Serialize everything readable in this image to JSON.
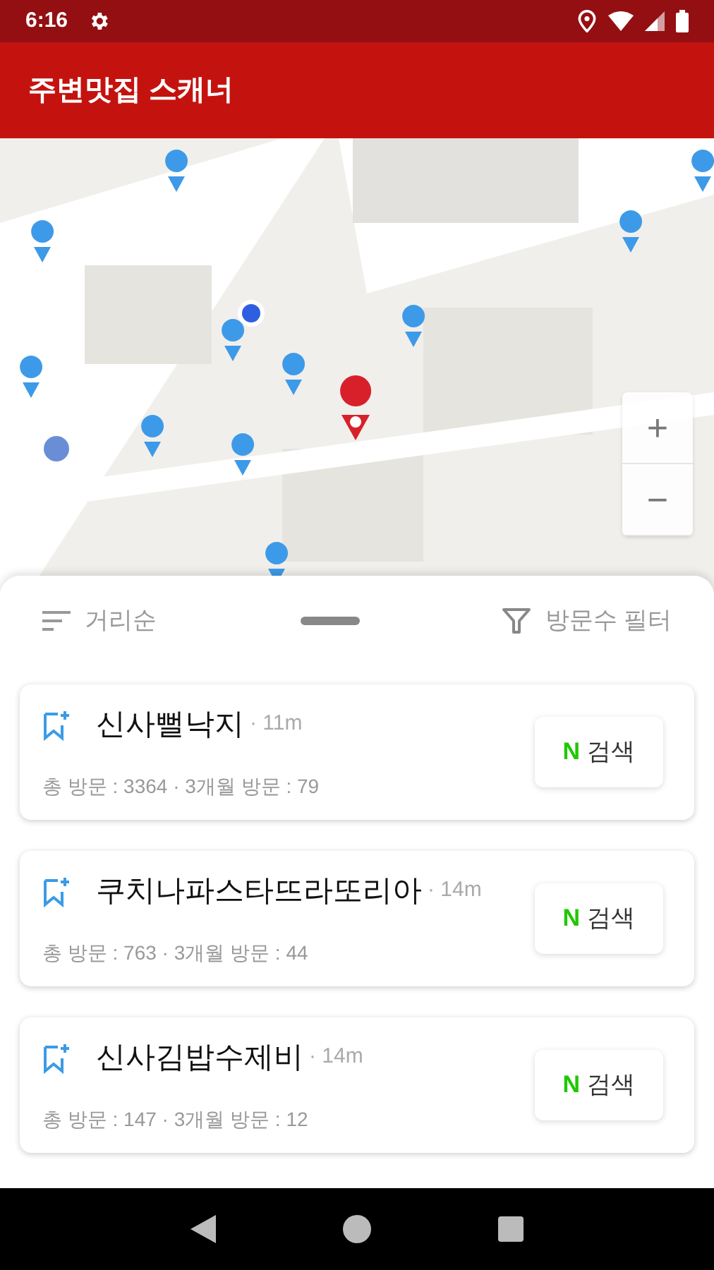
{
  "status_bar": {
    "time": "6:16"
  },
  "app_bar": {
    "title": "주변맛집 스캐너"
  },
  "map": {
    "kind": "picture",
    "zoom_controls": [
      "+",
      "−"
    ]
  },
  "sheet": {
    "sort": {
      "label": "거리순"
    },
    "filter": {
      "label": "방문수 필터"
    }
  },
  "restaurants": [
    {
      "name": "신사뻘낙지",
      "distance": "· 11m",
      "stats": "총 방문 : 3364 · 3개월 방문 : 79",
      "search": {
        "brand": "N",
        "label": "검색"
      }
    },
    {
      "name": "쿠치나파스타뜨라또리아",
      "distance": "· 14m",
      "stats": "총 방문 : 763 · 3개월 방문 : 44",
      "search": {
        "brand": "N",
        "label": "검색"
      }
    },
    {
      "name": "신사김밥수제비",
      "distance": "· 14m",
      "stats": "총 방문 : 147 · 3개월 방문 : 12",
      "search": {
        "brand": "N",
        "label": "검색"
      }
    }
  ]
}
